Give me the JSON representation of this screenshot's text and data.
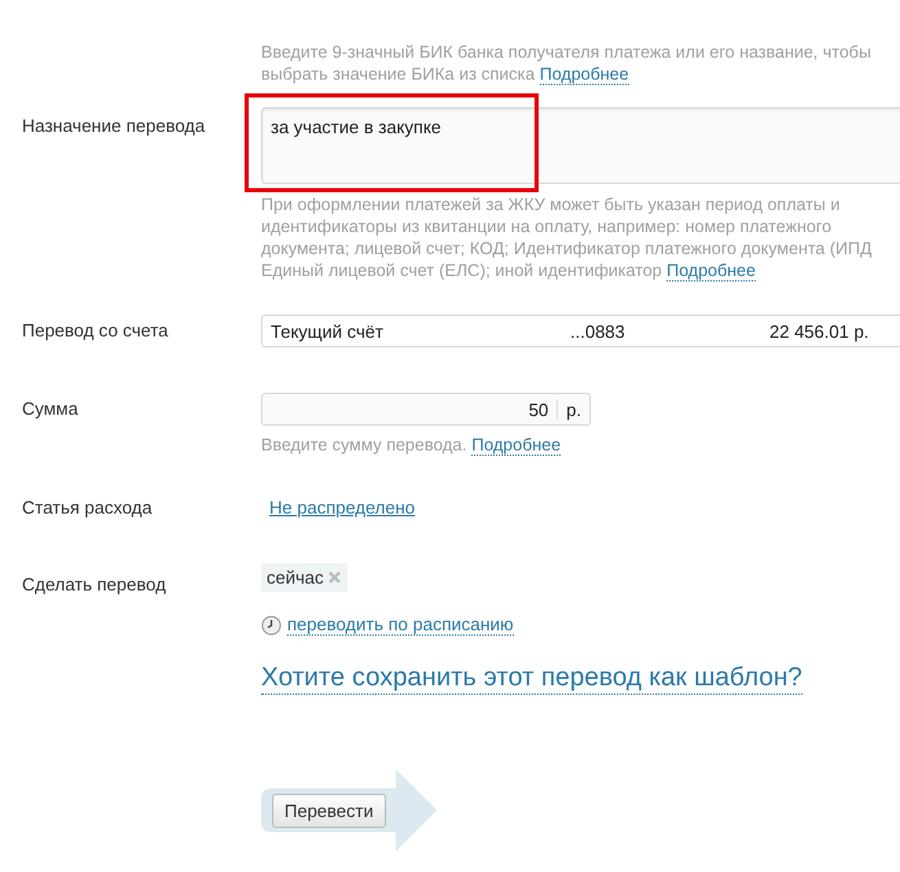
{
  "bik_hint": {
    "lines": [
      "Введите 9-значный БИК банка получателя платежа или его название, чтобы",
      "выбрать значение БИКа из списка"
    ],
    "link": "Подробнее"
  },
  "purpose": {
    "label": "Назначение перевода",
    "value": "за участие в закупке",
    "highlighted": true,
    "hint_lines": [
      "При оформлении платежей за ЖКУ может быть указан период оплаты и",
      "идентификаторы из квитанции на оплату, например: номер платежного",
      "документа; лицевой счет; КОД; Идентификатор платежного документа (ИПД",
      "Единый лицевой счет (ЕЛС); иной идентификатор"
    ],
    "link": "Подробнее"
  },
  "account": {
    "label": "Перевод со счета",
    "name": "Текущий счёт",
    "number": "...0883",
    "balance": "22 456.01 р."
  },
  "amount": {
    "label": "Сумма",
    "value": "50",
    "currency": "р.",
    "hint": "Введите сумму перевода.",
    "link": "Подробнее"
  },
  "expense": {
    "label": "Статья расхода",
    "link": "Не распределено"
  },
  "timing": {
    "label": "Сделать перевод",
    "chip": "сейчас",
    "schedule_link": "переводить по расписанию"
  },
  "template_link": "Хотите сохранить этот перевод как шаблон?",
  "submit": "Перевести"
}
